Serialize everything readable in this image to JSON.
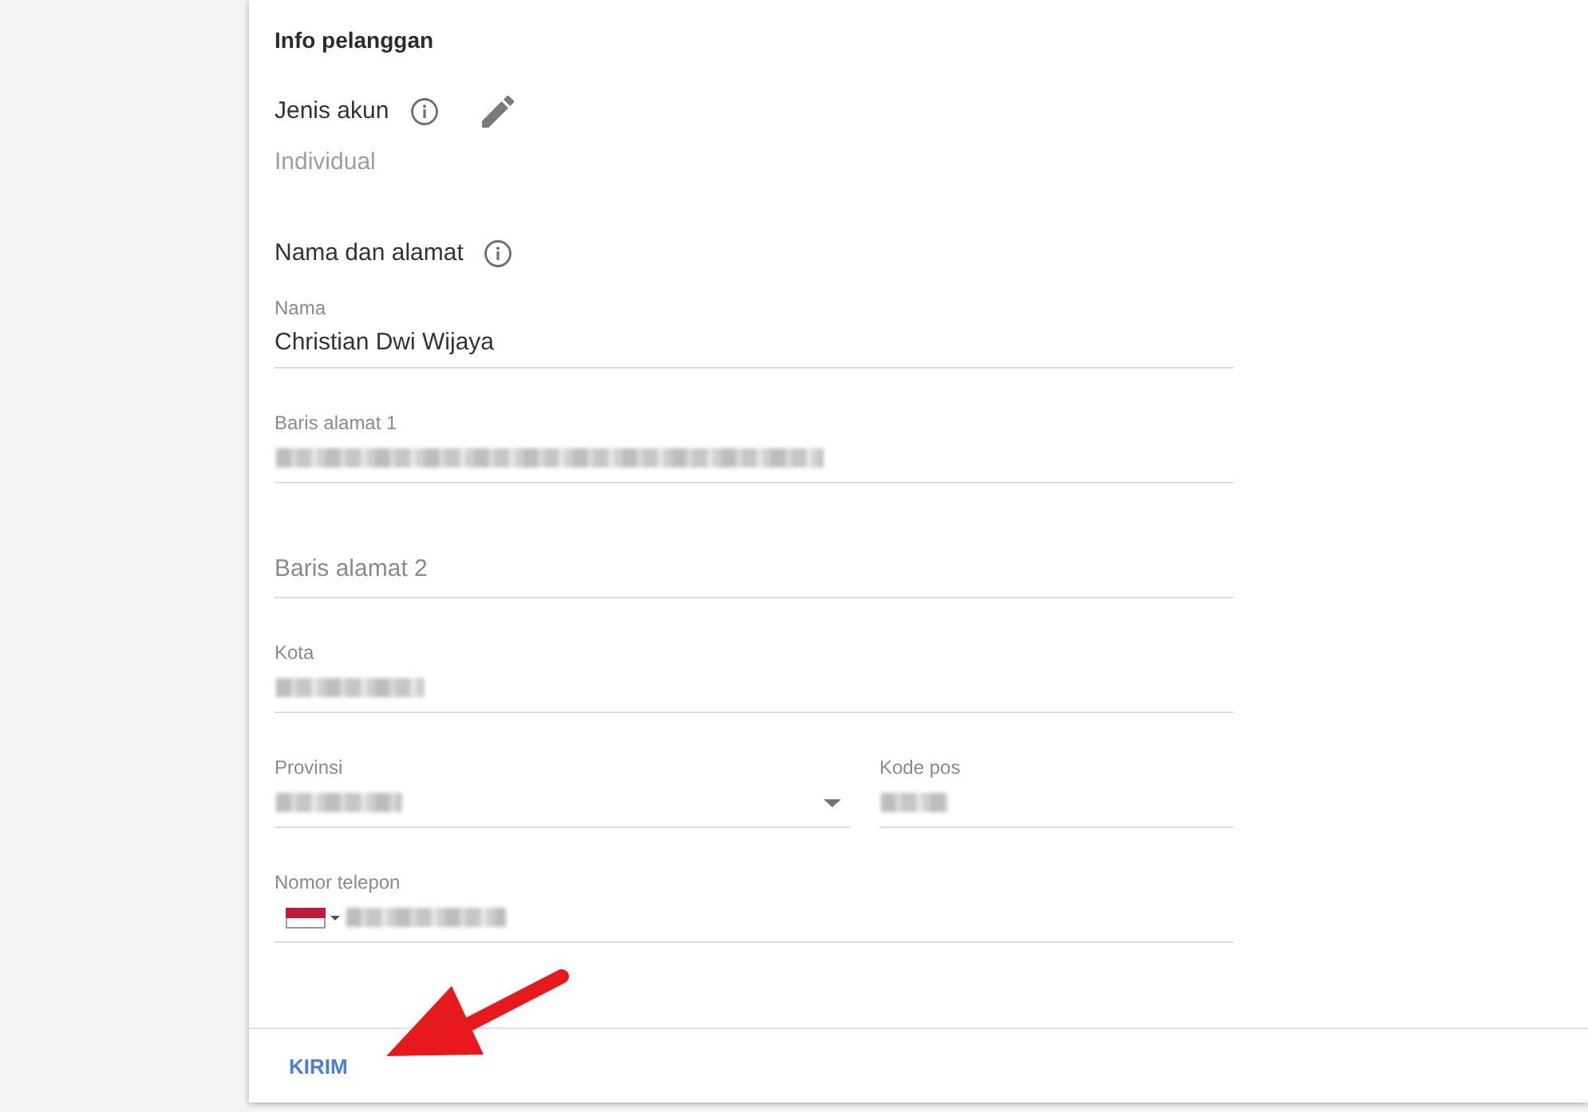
{
  "section_title": "Info pelanggan",
  "account_type": {
    "label": "Jenis akun",
    "value": "Individual"
  },
  "address_heading": "Nama dan alamat",
  "rows": [
    [
      {
        "kind": "text",
        "label": "Nama",
        "value": "Christian Dwi Wijaya",
        "redacted": false
      }
    ],
    [
      {
        "kind": "text",
        "label": "Baris alamat 1",
        "redacted": true
      }
    ],
    [
      {
        "kind": "text",
        "placeholder": "Baris alamat 2",
        "redacted": false
      }
    ],
    [
      {
        "kind": "text",
        "label": "Kota",
        "redacted": true
      }
    ],
    [
      {
        "kind": "select",
        "label": "Provinsi",
        "redacted": true
      },
      {
        "kind": "text",
        "label": "Kode pos",
        "redacted": true
      }
    ],
    [
      {
        "kind": "phone",
        "label": "Nomor telepon",
        "redacted": true
      }
    ]
  ],
  "submit_button": "KIRIM",
  "annotation": {
    "kind": "arrow"
  }
}
